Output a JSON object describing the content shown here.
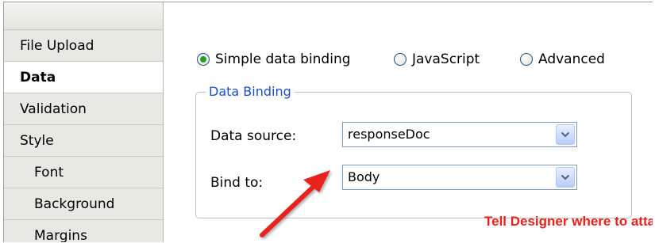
{
  "sidebar": {
    "items": [
      {
        "label": "File Upload"
      },
      {
        "label": "Data"
      },
      {
        "label": "Validation"
      },
      {
        "label": "Style"
      },
      {
        "label": "Font"
      },
      {
        "label": "Background"
      },
      {
        "label": "Margins"
      }
    ]
  },
  "binding_mode": {
    "options": [
      {
        "label": "Simple data binding",
        "checked": true
      },
      {
        "label": "JavaScript",
        "checked": false
      },
      {
        "label": "Advanced",
        "checked": false
      }
    ]
  },
  "data_binding": {
    "legend": "Data Binding",
    "data_source_label": "Data source:",
    "data_source_value": "responseDoc",
    "bind_to_label": "Bind to:",
    "bind_to_value": "Body"
  },
  "annotation": {
    "text": "Tell Designer where to attach file to",
    "color": "#e8201e"
  },
  "colors": {
    "sidebar_bg": "#e9e9e3",
    "legend_text": "#1a4fc8",
    "radio_selected": "#21a121",
    "combo_border": "#7f9db9"
  }
}
